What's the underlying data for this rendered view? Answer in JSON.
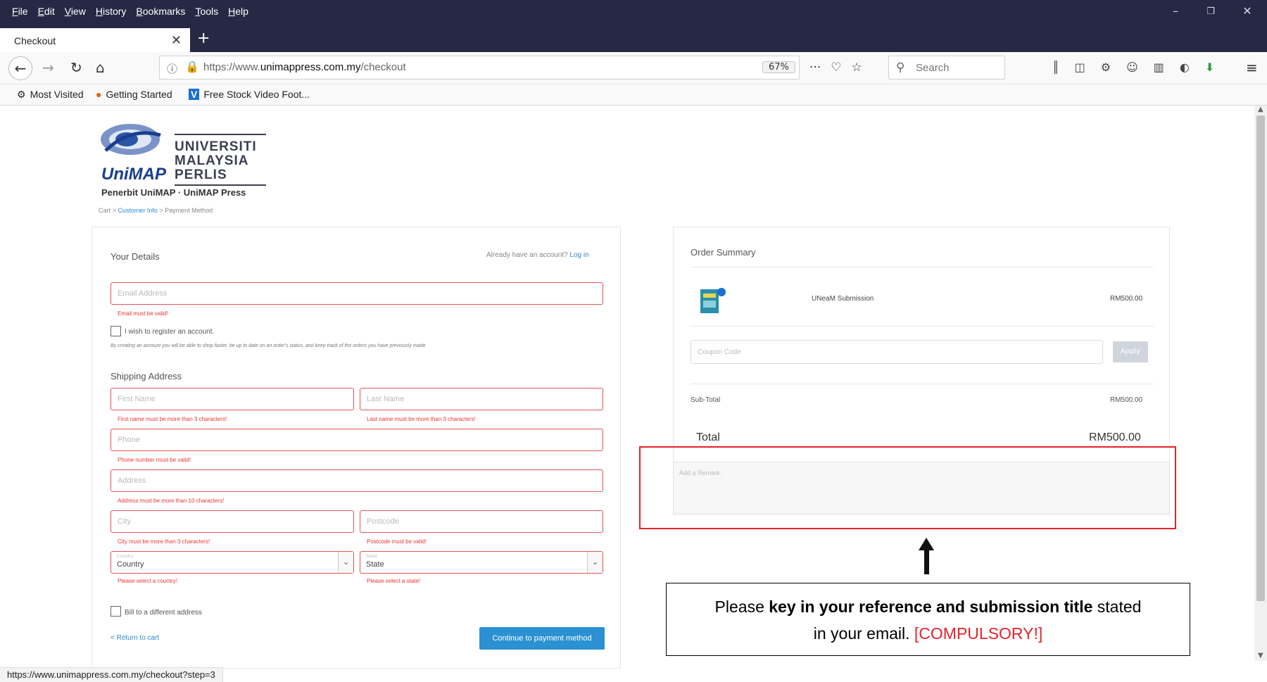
{
  "menu": [
    "File",
    "Edit",
    "View",
    "History",
    "Bookmarks",
    "Tools",
    "Help"
  ],
  "tab": {
    "title": "Checkout"
  },
  "address_bar": {
    "url_prefix": "https://www.",
    "url_domain": "unimappress.com.my",
    "url_path": "/checkout",
    "zoom": "67%"
  },
  "search": {
    "placeholder": "Search"
  },
  "bookmarks": [
    {
      "label": "Most Visited",
      "icon": "gear-icon"
    },
    {
      "label": "Getting Started",
      "icon": "firefox-icon"
    },
    {
      "label": "Free Stock Video Foot...",
      "icon": "v-logo-icon"
    }
  ],
  "logo": {
    "line1": "UNIVERSITI",
    "line2": "MALAYSIA",
    "line3": "PERLIS",
    "brand": "UniMAP",
    "press": "Penerbit UniMAP · UniMAP Press"
  },
  "breadcrumb": {
    "cart": "Cart",
    "customer_info": "Customer Info",
    "payment": "Payment Method",
    "sep": ">"
  },
  "details": {
    "title": "Your Details",
    "account_prompt": "Already have an account?",
    "login": "Log in",
    "email_placeholder": "Email Address",
    "email_error": "Email must be valid!",
    "register_label": "I wish to register an account.",
    "register_note": "By creating an account you will be able to shop faster, be up to date on an order's status, and keep track of the orders you have previously made."
  },
  "shipping": {
    "title": "Shipping Address",
    "first_name": "First Name",
    "first_name_error": "First name must be more than 3 characters!",
    "last_name": "Last Name",
    "last_name_error": "Last name must be more than 3 characters!",
    "phone": "Phone",
    "phone_error": "Phone number must be valid!",
    "address": "Address",
    "address_error": "Address must be more than 10 characters!",
    "city": "City",
    "city_error": "City must be more than 3 characters!",
    "postcode": "Postcode",
    "postcode_error": "Postcode must be valid!",
    "country_small": "Country",
    "country": "Country",
    "country_error": "Please select a country!",
    "state_small": "State",
    "state": "State",
    "state_error": "Please select a state!",
    "bill_label": "Bill to a different address",
    "return": "< Return to cart",
    "continue": "Continue to payment method"
  },
  "summary": {
    "title": "Order Summary",
    "item_name": "UNeaM Submission",
    "item_price": "RM500.00",
    "coupon_placeholder": "Coupon Code",
    "apply": "Apply",
    "subtotal_label": "Sub-Total",
    "subtotal": "RM500.00",
    "total_label": "Total",
    "total": "RM500.00",
    "remark_placeholder": "Add a Remark."
  },
  "note": {
    "part1": "Please ",
    "bold": "key in your reference and submission title",
    "part2": " stated",
    "part3": "in your email. ",
    "red": "[COMPULSORY!]"
  },
  "status_url": "https://www.unimappress.com.my/checkout?step=3",
  "colors": {
    "chrome": "#262944",
    "error": "#e05555",
    "accent": "#2b91d2",
    "annotation": "#e4242a"
  }
}
